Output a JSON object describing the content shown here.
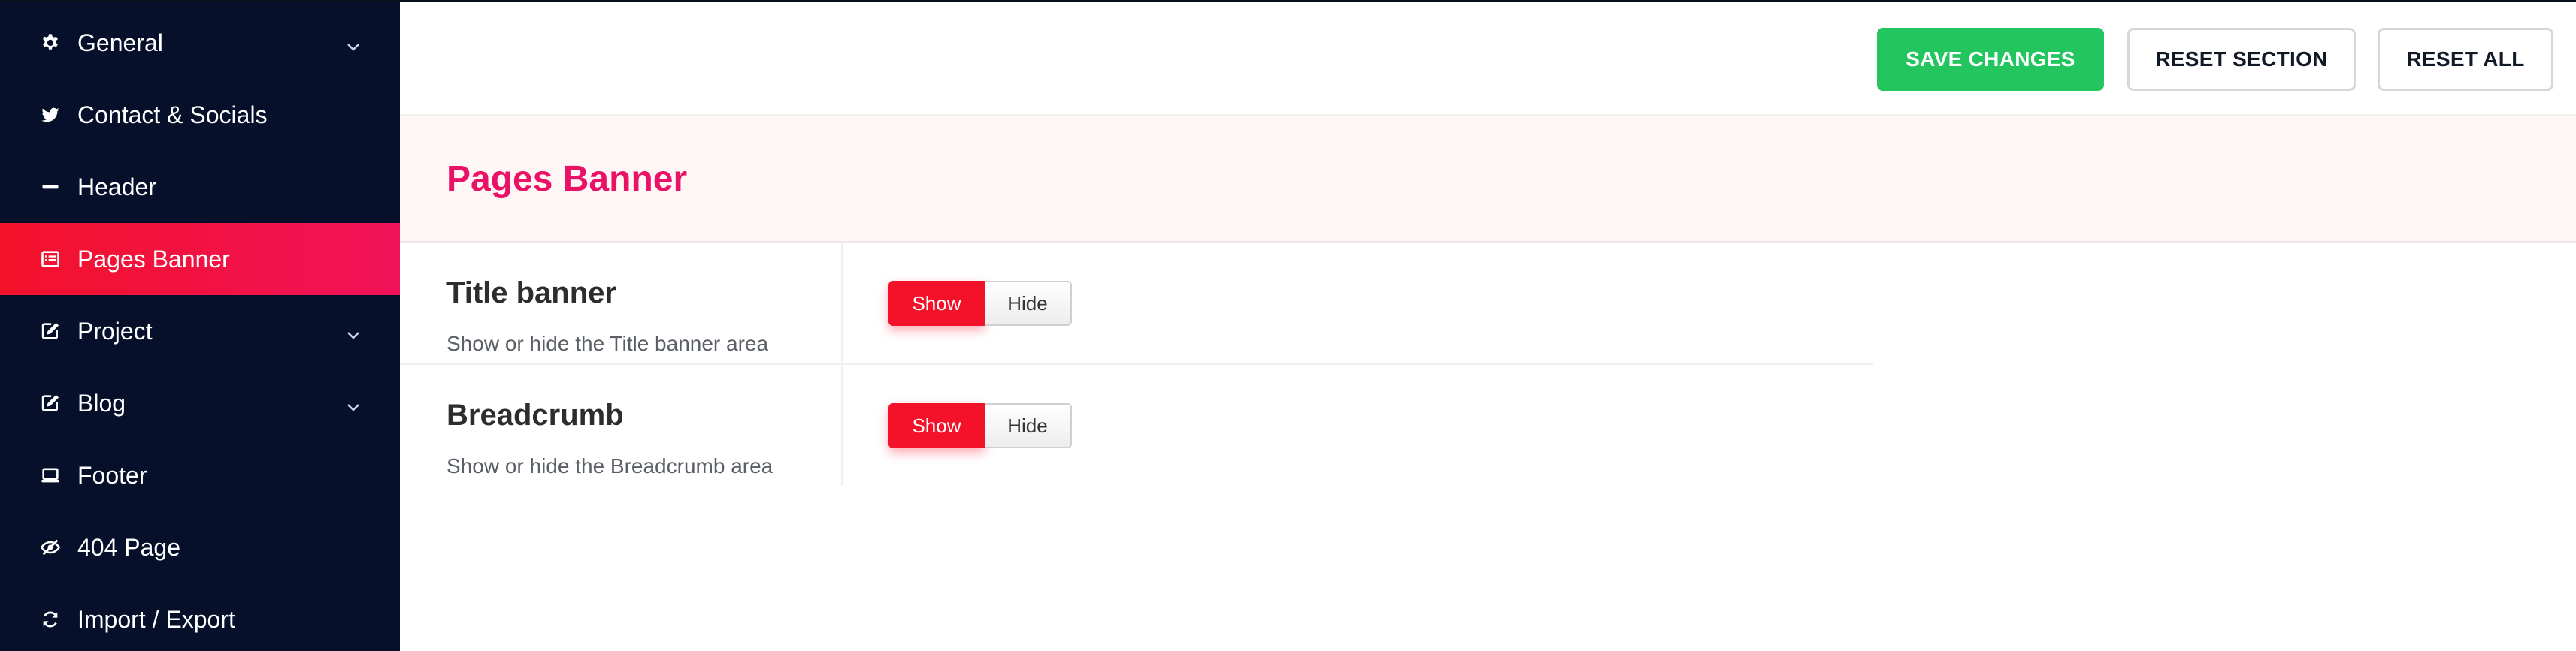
{
  "sidebar": {
    "items": [
      {
        "label": "General",
        "icon": "gear-icon",
        "has_submenu": true,
        "active": false
      },
      {
        "label": "Contact & Socials",
        "icon": "twitter-icon",
        "has_submenu": false,
        "active": false
      },
      {
        "label": "Header",
        "icon": "minus-icon",
        "has_submenu": false,
        "active": false
      },
      {
        "label": "Pages Banner",
        "icon": "list-alt-icon",
        "has_submenu": false,
        "active": true
      },
      {
        "label": "Project",
        "icon": "edit-icon",
        "has_submenu": true,
        "active": false
      },
      {
        "label": "Blog",
        "icon": "edit-icon",
        "has_submenu": true,
        "active": false
      },
      {
        "label": "Footer",
        "icon": "laptop-icon",
        "has_submenu": false,
        "active": false
      },
      {
        "label": "404 Page",
        "icon": "eye-slash-icon",
        "has_submenu": false,
        "active": false
      },
      {
        "label": "Import / Export",
        "icon": "refresh-icon",
        "has_submenu": false,
        "active": false
      }
    ]
  },
  "toolbar": {
    "save_label": "SAVE CHANGES",
    "reset_section_label": "RESET SECTION",
    "reset_all_label": "RESET ALL"
  },
  "section": {
    "title": "Pages Banner"
  },
  "options": [
    {
      "title": "Title banner",
      "description": "Show or hide the Title banner area",
      "on_label": "Show",
      "off_label": "Hide",
      "selected": "Show"
    },
    {
      "title": "Breadcrumb",
      "description": "Show or hide the Breadcrumb area",
      "on_label": "Show",
      "off_label": "Hide",
      "selected": "Show"
    }
  ],
  "colors": {
    "sidebar_bg": "#06102a",
    "accent": "#f3122a",
    "title_pink": "#ea1266",
    "save_green": "#22c55e"
  }
}
